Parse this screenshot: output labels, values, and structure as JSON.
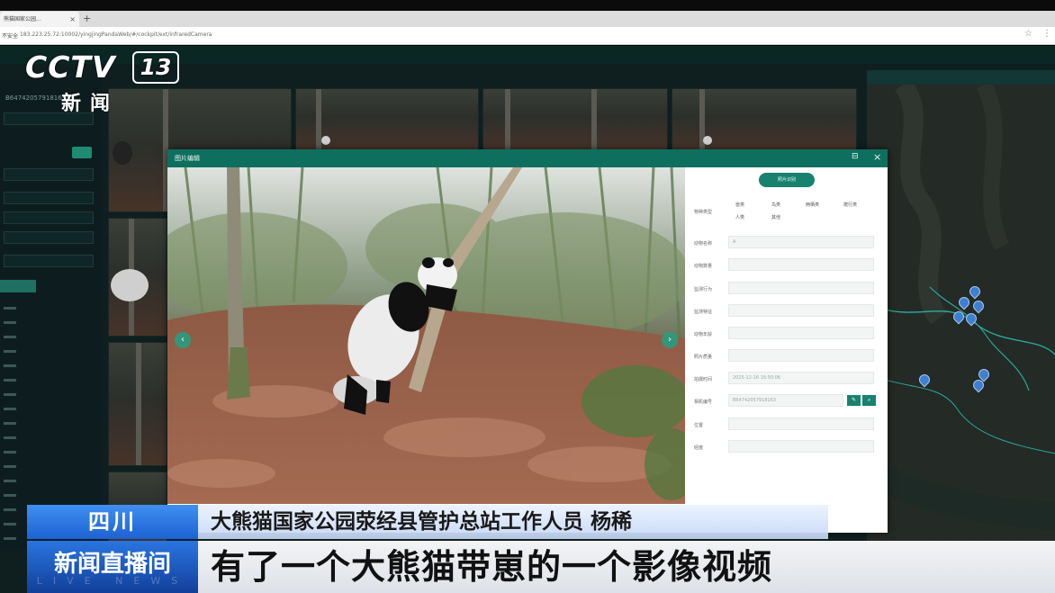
{
  "browser": {
    "tab_title": "熊猫国家公园...",
    "tab_close": "×",
    "tab_new": "+",
    "security_label": "不安全",
    "url": "183.223.25.72:10002/yingjingPandaWeb/#/cockpit/ext/infraredCamera",
    "star_icon": "☆",
    "menu_icon": "⋮"
  },
  "sidebar": {
    "device_id": "B64742057918163"
  },
  "dialog": {
    "title": "图片编辑",
    "max_icon": "⊟",
    "close_icon": "×",
    "prev_icon": "‹",
    "next_icon": "›",
    "form": {
      "pill_label": "照片识别",
      "rows": [
        {
          "label": "物种类型",
          "value": ""
        },
        {
          "label": "动物名称",
          "value": "A"
        },
        {
          "label": "动物数量",
          "value": ""
        },
        {
          "label": "监测行为",
          "value": ""
        },
        {
          "label": "监测特征",
          "value": ""
        },
        {
          "label": "动物年龄",
          "value": ""
        },
        {
          "label": "照片质量",
          "value": ""
        },
        {
          "label": "拍摄时间",
          "value": "2025-12-16 16:50:06"
        },
        {
          "label": "相机编号",
          "value": "B64742057918163"
        },
        {
          "label": "位置",
          "value": ""
        },
        {
          "label": "经度",
          "value": ""
        }
      ],
      "species_chips": [
        "兽类",
        "鸟类",
        "两栖类",
        "爬行类",
        "人类",
        "其他"
      ],
      "edit_icon": "✎",
      "search_icon": "⌕"
    }
  },
  "overlay": {
    "channel_cctv": "CCTV",
    "channel_number": "13",
    "channel_news": "新闻",
    "region": "四川",
    "speaker": "大熊猫国家公园荥经县管护总站工作人员 杨稀",
    "show_name": "新闻直播间",
    "show_live": "LIVE NEWS",
    "subtitle": "有了一个大熊猫带崽的一个影像视频"
  },
  "colors": {
    "accent": "#0e6f5f",
    "overlay_blue": "#1d62d3"
  }
}
